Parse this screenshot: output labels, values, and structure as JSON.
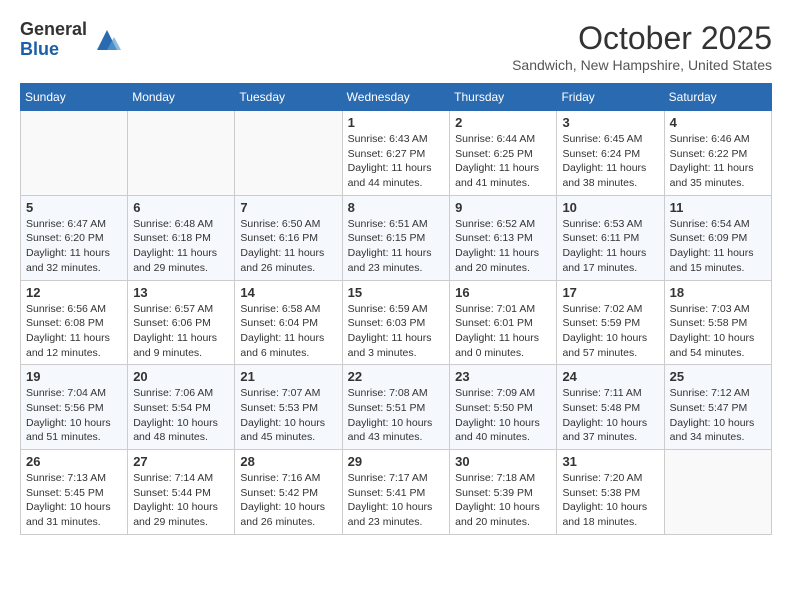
{
  "logo": {
    "general": "General",
    "blue": "Blue"
  },
  "header": {
    "month_year": "October 2025",
    "location": "Sandwich, New Hampshire, United States"
  },
  "weekdays": [
    "Sunday",
    "Monday",
    "Tuesday",
    "Wednesday",
    "Thursday",
    "Friday",
    "Saturday"
  ],
  "weeks": [
    [
      {
        "day": "",
        "info": ""
      },
      {
        "day": "",
        "info": ""
      },
      {
        "day": "",
        "info": ""
      },
      {
        "day": "1",
        "info": "Sunrise: 6:43 AM\nSunset: 6:27 PM\nDaylight: 11 hours\nand 44 minutes."
      },
      {
        "day": "2",
        "info": "Sunrise: 6:44 AM\nSunset: 6:25 PM\nDaylight: 11 hours\nand 41 minutes."
      },
      {
        "day": "3",
        "info": "Sunrise: 6:45 AM\nSunset: 6:24 PM\nDaylight: 11 hours\nand 38 minutes."
      },
      {
        "day": "4",
        "info": "Sunrise: 6:46 AM\nSunset: 6:22 PM\nDaylight: 11 hours\nand 35 minutes."
      }
    ],
    [
      {
        "day": "5",
        "info": "Sunrise: 6:47 AM\nSunset: 6:20 PM\nDaylight: 11 hours\nand 32 minutes."
      },
      {
        "day": "6",
        "info": "Sunrise: 6:48 AM\nSunset: 6:18 PM\nDaylight: 11 hours\nand 29 minutes."
      },
      {
        "day": "7",
        "info": "Sunrise: 6:50 AM\nSunset: 6:16 PM\nDaylight: 11 hours\nand 26 minutes."
      },
      {
        "day": "8",
        "info": "Sunrise: 6:51 AM\nSunset: 6:15 PM\nDaylight: 11 hours\nand 23 minutes."
      },
      {
        "day": "9",
        "info": "Sunrise: 6:52 AM\nSunset: 6:13 PM\nDaylight: 11 hours\nand 20 minutes."
      },
      {
        "day": "10",
        "info": "Sunrise: 6:53 AM\nSunset: 6:11 PM\nDaylight: 11 hours\nand 17 minutes."
      },
      {
        "day": "11",
        "info": "Sunrise: 6:54 AM\nSunset: 6:09 PM\nDaylight: 11 hours\nand 15 minutes."
      }
    ],
    [
      {
        "day": "12",
        "info": "Sunrise: 6:56 AM\nSunset: 6:08 PM\nDaylight: 11 hours\nand 12 minutes."
      },
      {
        "day": "13",
        "info": "Sunrise: 6:57 AM\nSunset: 6:06 PM\nDaylight: 11 hours\nand 9 minutes."
      },
      {
        "day": "14",
        "info": "Sunrise: 6:58 AM\nSunset: 6:04 PM\nDaylight: 11 hours\nand 6 minutes."
      },
      {
        "day": "15",
        "info": "Sunrise: 6:59 AM\nSunset: 6:03 PM\nDaylight: 11 hours\nand 3 minutes."
      },
      {
        "day": "16",
        "info": "Sunrise: 7:01 AM\nSunset: 6:01 PM\nDaylight: 11 hours\nand 0 minutes."
      },
      {
        "day": "17",
        "info": "Sunrise: 7:02 AM\nSunset: 5:59 PM\nDaylight: 10 hours\nand 57 minutes."
      },
      {
        "day": "18",
        "info": "Sunrise: 7:03 AM\nSunset: 5:58 PM\nDaylight: 10 hours\nand 54 minutes."
      }
    ],
    [
      {
        "day": "19",
        "info": "Sunrise: 7:04 AM\nSunset: 5:56 PM\nDaylight: 10 hours\nand 51 minutes."
      },
      {
        "day": "20",
        "info": "Sunrise: 7:06 AM\nSunset: 5:54 PM\nDaylight: 10 hours\nand 48 minutes."
      },
      {
        "day": "21",
        "info": "Sunrise: 7:07 AM\nSunset: 5:53 PM\nDaylight: 10 hours\nand 45 minutes."
      },
      {
        "day": "22",
        "info": "Sunrise: 7:08 AM\nSunset: 5:51 PM\nDaylight: 10 hours\nand 43 minutes."
      },
      {
        "day": "23",
        "info": "Sunrise: 7:09 AM\nSunset: 5:50 PM\nDaylight: 10 hours\nand 40 minutes."
      },
      {
        "day": "24",
        "info": "Sunrise: 7:11 AM\nSunset: 5:48 PM\nDaylight: 10 hours\nand 37 minutes."
      },
      {
        "day": "25",
        "info": "Sunrise: 7:12 AM\nSunset: 5:47 PM\nDaylight: 10 hours\nand 34 minutes."
      }
    ],
    [
      {
        "day": "26",
        "info": "Sunrise: 7:13 AM\nSunset: 5:45 PM\nDaylight: 10 hours\nand 31 minutes."
      },
      {
        "day": "27",
        "info": "Sunrise: 7:14 AM\nSunset: 5:44 PM\nDaylight: 10 hours\nand 29 minutes."
      },
      {
        "day": "28",
        "info": "Sunrise: 7:16 AM\nSunset: 5:42 PM\nDaylight: 10 hours\nand 26 minutes."
      },
      {
        "day": "29",
        "info": "Sunrise: 7:17 AM\nSunset: 5:41 PM\nDaylight: 10 hours\nand 23 minutes."
      },
      {
        "day": "30",
        "info": "Sunrise: 7:18 AM\nSunset: 5:39 PM\nDaylight: 10 hours\nand 20 minutes."
      },
      {
        "day": "31",
        "info": "Sunrise: 7:20 AM\nSunset: 5:38 PM\nDaylight: 10 hours\nand 18 minutes."
      },
      {
        "day": "",
        "info": ""
      }
    ]
  ]
}
